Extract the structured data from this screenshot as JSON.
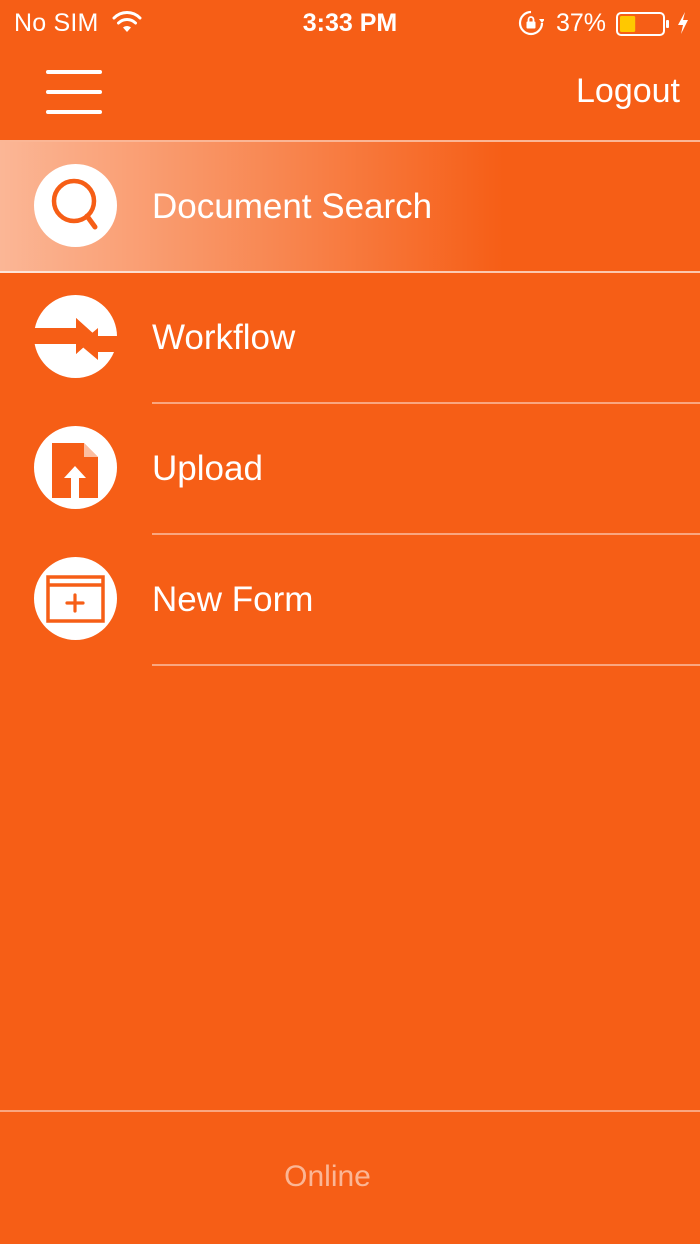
{
  "status_bar": {
    "carrier": "No SIM",
    "time": "3:33 PM",
    "battery_percent": "37%",
    "battery_level": 0.37,
    "wifi_icon": "wifi-icon",
    "lock_icon": "rotation-lock-icon",
    "charging_icon": "charging-bolt-icon"
  },
  "nav": {
    "menu_icon": "hamburger-menu-icon",
    "logout_label": "Logout"
  },
  "menu": {
    "items": [
      {
        "label": "Document Search",
        "icon": "search-icon",
        "selected": true
      },
      {
        "label": "Workflow",
        "icon": "workflow-arrows-icon",
        "selected": false
      },
      {
        "label": "Upload",
        "icon": "upload-document-icon",
        "selected": false
      },
      {
        "label": "New Form",
        "icon": "new-form-icon",
        "selected": false
      }
    ]
  },
  "footer": {
    "connection_status": "Online"
  },
  "colors": {
    "background": "#F65E16",
    "icon_foreground": "#F65E16",
    "text": "#FFFFFF",
    "battery_fill": "#FFC800"
  }
}
